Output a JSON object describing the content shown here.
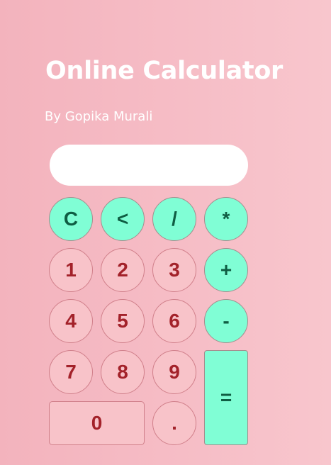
{
  "app": {
    "title": "Online Calculator",
    "subtitle": "By Gopika Murali"
  },
  "display": {
    "value": ""
  },
  "keys": {
    "clear": "C",
    "backspace": "<",
    "divide": "/",
    "multiply": "*",
    "one": "1",
    "two": "2",
    "three": "3",
    "add": "+",
    "four": "4",
    "five": "5",
    "six": "6",
    "subtract": "-",
    "seven": "7",
    "eight": "8",
    "nine": "9",
    "equals": "=",
    "zero": "0",
    "decimal": "."
  },
  "colors": {
    "background": "#f6bdc6",
    "number_key": "#f8c3c9",
    "number_text": "#a3222a",
    "operator_key": "#80fed5",
    "operator_text": "#0f5d43",
    "display": "#ffffff"
  }
}
